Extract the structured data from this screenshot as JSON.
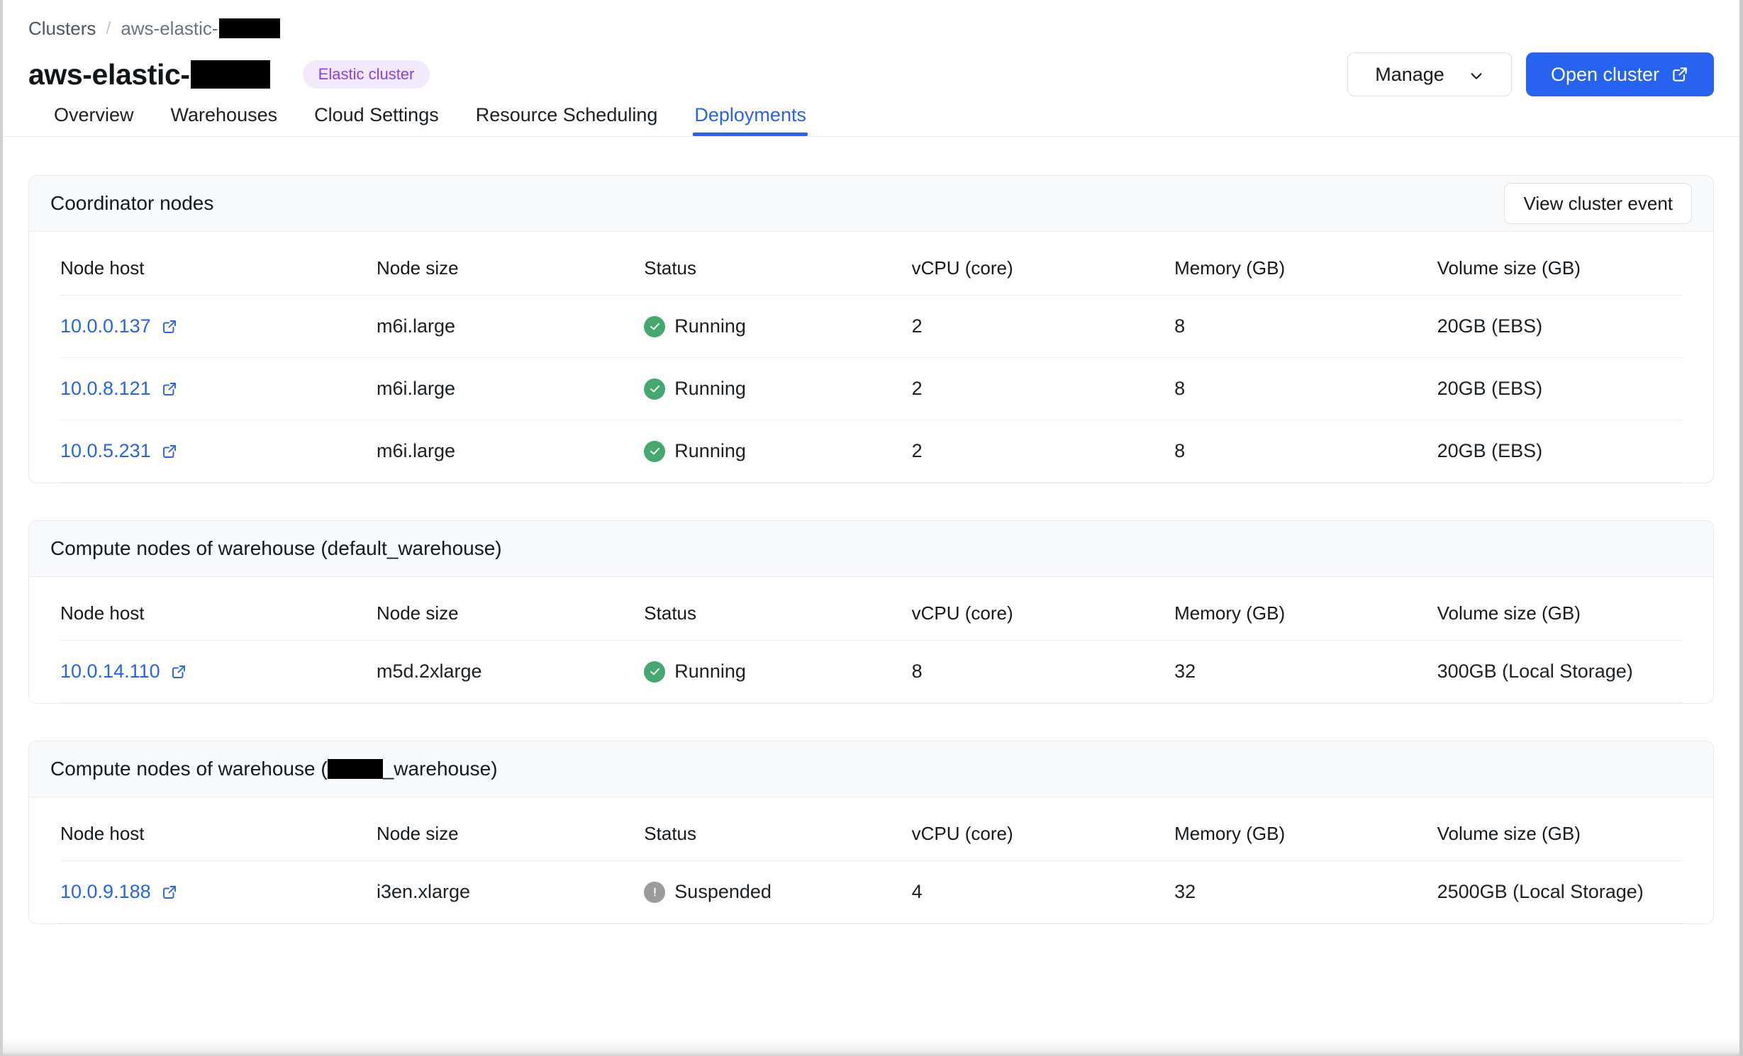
{
  "breadcrumb": {
    "root_label": "Clusters",
    "separator": "/",
    "current_prefix": "aws-elastic-",
    "current_redacted": true
  },
  "header": {
    "title_prefix": "aws-elastic-",
    "title_redacted": true,
    "badge_label": "Elastic cluster",
    "manage_label": "Manage",
    "manage_icon": "chevron-down-icon",
    "open_cluster_label": "Open cluster",
    "open_cluster_icon": "external-link-icon"
  },
  "tabs": [
    {
      "label": "Overview",
      "active": false
    },
    {
      "label": "Warehouses",
      "active": false
    },
    {
      "label": "Cloud Settings",
      "active": false
    },
    {
      "label": "Resource Scheduling",
      "active": false
    },
    {
      "label": "Deployments",
      "active": true
    }
  ],
  "columns": [
    "Node host",
    "Node size",
    "Status",
    "vCPU (core)",
    "Memory (GB)",
    "Volume size (GB)"
  ],
  "cards": [
    {
      "title": "Coordinator nodes",
      "title_has_redaction": false,
      "action_label": "View cluster event",
      "has_action": true,
      "rows": [
        {
          "host": "10.0.0.137",
          "size": "m6i.large",
          "status": "Running",
          "status_kind": "running",
          "vcpu": "2",
          "memory": "8",
          "volume": "20GB (EBS)"
        },
        {
          "host": "10.0.8.121",
          "size": "m6i.large",
          "status": "Running",
          "status_kind": "running",
          "vcpu": "2",
          "memory": "8",
          "volume": "20GB (EBS)"
        },
        {
          "host": "10.0.5.231",
          "size": "m6i.large",
          "status": "Running",
          "status_kind": "running",
          "vcpu": "2",
          "memory": "8",
          "volume": "20GB (EBS)"
        }
      ]
    },
    {
      "title": "Compute nodes of warehouse (default_warehouse)",
      "title_has_redaction": false,
      "action_label": "",
      "has_action": false,
      "rows": [
        {
          "host": "10.0.14.110",
          "size": "m5d.2xlarge",
          "status": "Running",
          "status_kind": "running",
          "vcpu": "8",
          "memory": "32",
          "volume": "300GB (Local Storage)"
        }
      ]
    },
    {
      "title_prefix": "Compute nodes of warehouse (",
      "title_suffix": "_warehouse)",
      "title": "Compute nodes of warehouse (_warehouse)",
      "title_has_redaction": true,
      "action_label": "",
      "has_action": false,
      "rows": [
        {
          "host": "10.0.9.188",
          "size": "i3en.xlarge",
          "status": "Suspended",
          "status_kind": "suspended",
          "vcpu": "4",
          "memory": "32",
          "volume": "2500GB (Local Storage)"
        }
      ]
    }
  ],
  "colors": {
    "accent": "#2563f0",
    "badge_bg": "#f3e9fd",
    "badge_text": "#8b3ff0",
    "status_running": "#46a86e",
    "status_suspended": "#9b9b9b",
    "card_head_bg": "#f8f9fa",
    "border": "#e6e8eb",
    "link": "#2563f0"
  }
}
